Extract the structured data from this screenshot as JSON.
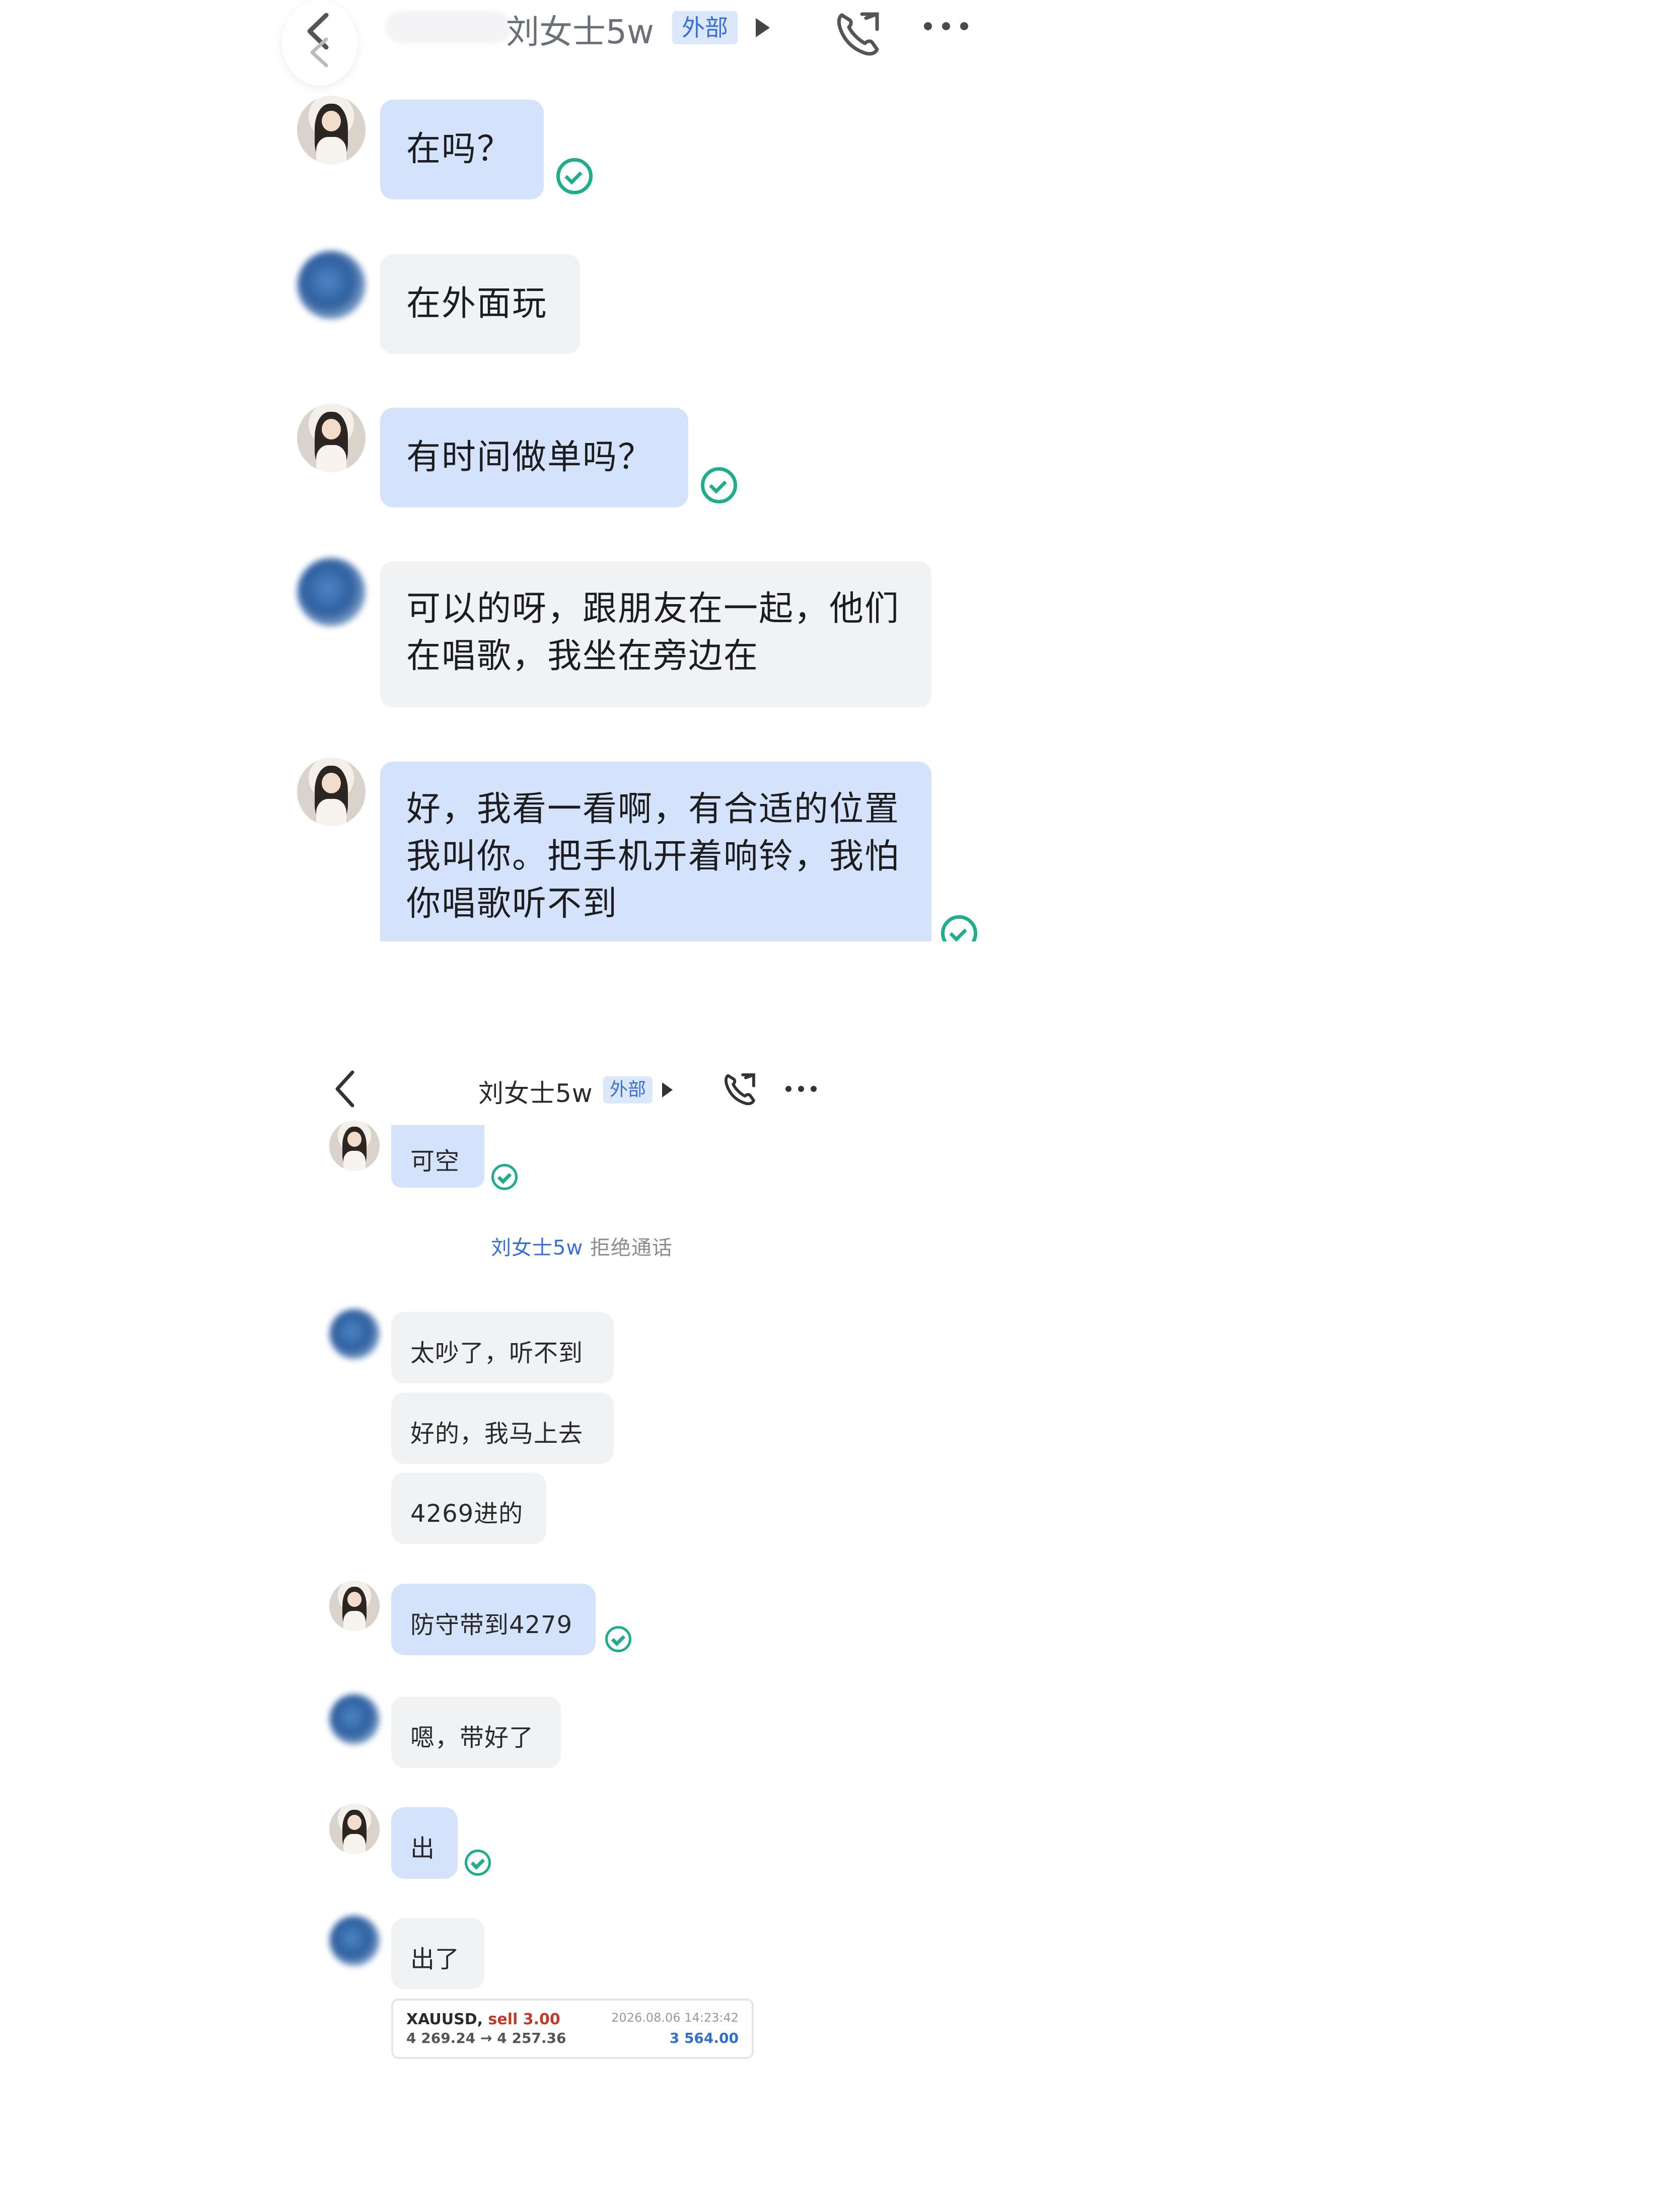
{
  "top": {
    "header": {
      "back_icon": "chevron-left-icon",
      "contact_name": "刘女士5w",
      "tag": "外部",
      "call_icon": "phone-icon",
      "more_icon": "more-dots-icon"
    },
    "messages": [
      {
        "from": "me",
        "text": "在吗？",
        "read": true
      },
      {
        "from": "other",
        "text": "在外面玩"
      },
      {
        "from": "me",
        "text": "有时间做单吗？",
        "read": true
      },
      {
        "from": "other",
        "text": "可以的呀，跟朋友在一起，他们在唱歌，我坐在旁边在"
      },
      {
        "from": "me",
        "text": "好，我看一看啊，有合适的位置我叫你。把手机开着响铃，我怕你唱歌听不到",
        "read": true
      }
    ]
  },
  "bottom": {
    "header": {
      "back_icon": "chevron-left-icon",
      "contact_name": "刘女士5w",
      "tag": "外部",
      "call_icon": "phone-icon",
      "more_icon": "more-dots-icon"
    },
    "messages": [
      {
        "from": "me",
        "text": "可空",
        "read": true
      },
      {
        "system": true,
        "name": "刘女士5w",
        "text": "拒绝通话"
      },
      {
        "from": "other",
        "text": "太吵了，听不到"
      },
      {
        "from": "other",
        "text": "好的，我马上去"
      },
      {
        "from": "other",
        "text": "4269进的"
      },
      {
        "from": "me",
        "text": "防守带到4279",
        "read": true
      },
      {
        "from": "other",
        "text": "嗯，带好了"
      },
      {
        "from": "me",
        "text": "出",
        "read": true
      },
      {
        "from": "other",
        "text": "出了"
      }
    ],
    "trade_card": {
      "symbol": "XAUUSD,",
      "side": "sell 3.00",
      "prices": "4 269.24 → 4 257.36",
      "datetime": "2026.08.06 14:23:42",
      "profit": "3 564.00",
      "colors": {
        "sell": "#c0392b",
        "profit": "#2f6fd1"
      }
    }
  },
  "colors": {
    "bubble_me": "#d4e3fb",
    "bubble_other": "#f1f2f4",
    "read_check": "#1fae8c",
    "tag_bg": "#dbe7fb",
    "tag_text": "#3a6fd8",
    "system_name": "#3a6fd8"
  }
}
